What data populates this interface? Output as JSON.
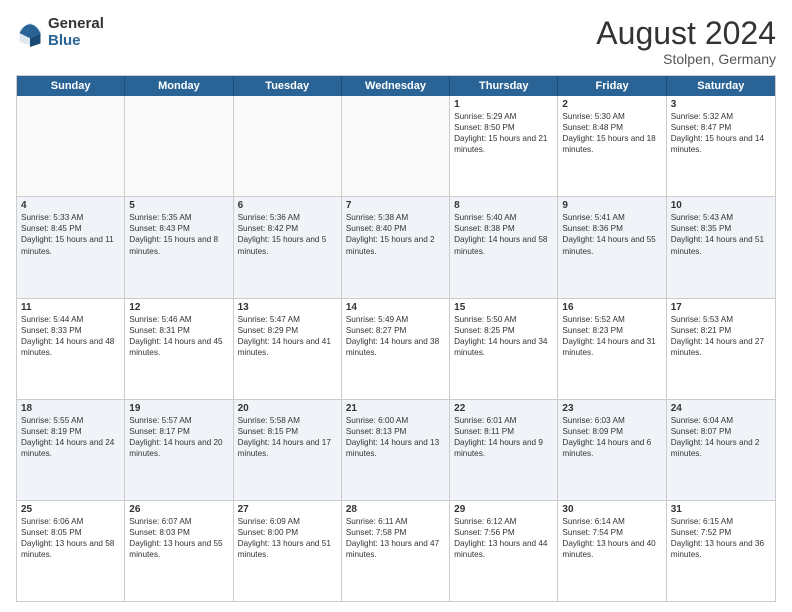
{
  "header": {
    "logo_general": "General",
    "logo_blue": "Blue",
    "title": "August 2024",
    "subtitle": "Stolpen, Germany"
  },
  "days": [
    "Sunday",
    "Monday",
    "Tuesday",
    "Wednesday",
    "Thursday",
    "Friday",
    "Saturday"
  ],
  "weeks": [
    [
      {
        "day": "",
        "text": ""
      },
      {
        "day": "",
        "text": ""
      },
      {
        "day": "",
        "text": ""
      },
      {
        "day": "",
        "text": ""
      },
      {
        "day": "1",
        "text": "Sunrise: 5:29 AM\nSunset: 8:50 PM\nDaylight: 15 hours and 21 minutes."
      },
      {
        "day": "2",
        "text": "Sunrise: 5:30 AM\nSunset: 8:48 PM\nDaylight: 15 hours and 18 minutes."
      },
      {
        "day": "3",
        "text": "Sunrise: 5:32 AM\nSunset: 8:47 PM\nDaylight: 15 hours and 14 minutes."
      }
    ],
    [
      {
        "day": "4",
        "text": "Sunrise: 5:33 AM\nSunset: 8:45 PM\nDaylight: 15 hours and 11 minutes."
      },
      {
        "day": "5",
        "text": "Sunrise: 5:35 AM\nSunset: 8:43 PM\nDaylight: 15 hours and 8 minutes."
      },
      {
        "day": "6",
        "text": "Sunrise: 5:36 AM\nSunset: 8:42 PM\nDaylight: 15 hours and 5 minutes."
      },
      {
        "day": "7",
        "text": "Sunrise: 5:38 AM\nSunset: 8:40 PM\nDaylight: 15 hours and 2 minutes."
      },
      {
        "day": "8",
        "text": "Sunrise: 5:40 AM\nSunset: 8:38 PM\nDaylight: 14 hours and 58 minutes."
      },
      {
        "day": "9",
        "text": "Sunrise: 5:41 AM\nSunset: 8:36 PM\nDaylight: 14 hours and 55 minutes."
      },
      {
        "day": "10",
        "text": "Sunrise: 5:43 AM\nSunset: 8:35 PM\nDaylight: 14 hours and 51 minutes."
      }
    ],
    [
      {
        "day": "11",
        "text": "Sunrise: 5:44 AM\nSunset: 8:33 PM\nDaylight: 14 hours and 48 minutes."
      },
      {
        "day": "12",
        "text": "Sunrise: 5:46 AM\nSunset: 8:31 PM\nDaylight: 14 hours and 45 minutes."
      },
      {
        "day": "13",
        "text": "Sunrise: 5:47 AM\nSunset: 8:29 PM\nDaylight: 14 hours and 41 minutes."
      },
      {
        "day": "14",
        "text": "Sunrise: 5:49 AM\nSunset: 8:27 PM\nDaylight: 14 hours and 38 minutes."
      },
      {
        "day": "15",
        "text": "Sunrise: 5:50 AM\nSunset: 8:25 PM\nDaylight: 14 hours and 34 minutes."
      },
      {
        "day": "16",
        "text": "Sunrise: 5:52 AM\nSunset: 8:23 PM\nDaylight: 14 hours and 31 minutes."
      },
      {
        "day": "17",
        "text": "Sunrise: 5:53 AM\nSunset: 8:21 PM\nDaylight: 14 hours and 27 minutes."
      }
    ],
    [
      {
        "day": "18",
        "text": "Sunrise: 5:55 AM\nSunset: 8:19 PM\nDaylight: 14 hours and 24 minutes."
      },
      {
        "day": "19",
        "text": "Sunrise: 5:57 AM\nSunset: 8:17 PM\nDaylight: 14 hours and 20 minutes."
      },
      {
        "day": "20",
        "text": "Sunrise: 5:58 AM\nSunset: 8:15 PM\nDaylight: 14 hours and 17 minutes."
      },
      {
        "day": "21",
        "text": "Sunrise: 6:00 AM\nSunset: 8:13 PM\nDaylight: 14 hours and 13 minutes."
      },
      {
        "day": "22",
        "text": "Sunrise: 6:01 AM\nSunset: 8:11 PM\nDaylight: 14 hours and 9 minutes."
      },
      {
        "day": "23",
        "text": "Sunrise: 6:03 AM\nSunset: 8:09 PM\nDaylight: 14 hours and 6 minutes."
      },
      {
        "day": "24",
        "text": "Sunrise: 6:04 AM\nSunset: 8:07 PM\nDaylight: 14 hours and 2 minutes."
      }
    ],
    [
      {
        "day": "25",
        "text": "Sunrise: 6:06 AM\nSunset: 8:05 PM\nDaylight: 13 hours and 58 minutes."
      },
      {
        "day": "26",
        "text": "Sunrise: 6:07 AM\nSunset: 8:03 PM\nDaylight: 13 hours and 55 minutes."
      },
      {
        "day": "27",
        "text": "Sunrise: 6:09 AM\nSunset: 8:00 PM\nDaylight: 13 hours and 51 minutes."
      },
      {
        "day": "28",
        "text": "Sunrise: 6:11 AM\nSunset: 7:58 PM\nDaylight: 13 hours and 47 minutes."
      },
      {
        "day": "29",
        "text": "Sunrise: 6:12 AM\nSunset: 7:56 PM\nDaylight: 13 hours and 44 minutes."
      },
      {
        "day": "30",
        "text": "Sunrise: 6:14 AM\nSunset: 7:54 PM\nDaylight: 13 hours and 40 minutes."
      },
      {
        "day": "31",
        "text": "Sunrise: 6:15 AM\nSunset: 7:52 PM\nDaylight: 13 hours and 36 minutes."
      }
    ]
  ]
}
